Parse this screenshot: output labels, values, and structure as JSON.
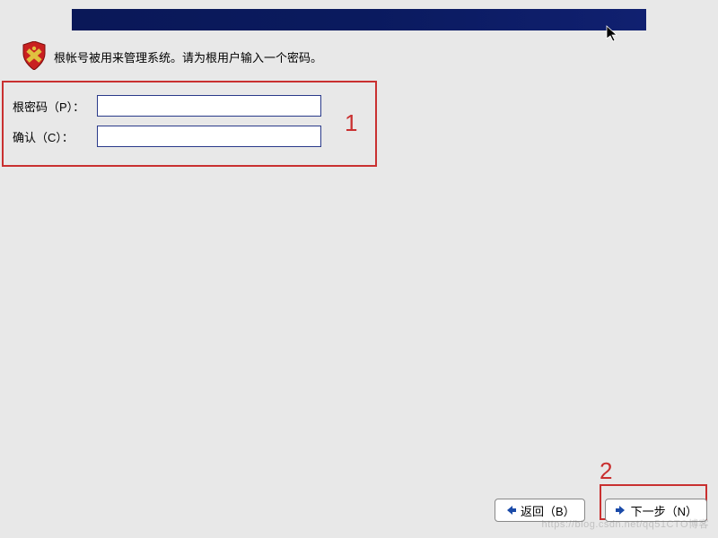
{
  "instruction": "根帐号被用来管理系统。请为根用户输入一个密码。",
  "form": {
    "password_label": "根密码（P）：",
    "password_value": "",
    "confirm_label": "确认（C）：",
    "confirm_value": ""
  },
  "buttons": {
    "back": "返回（B）",
    "next": "下一步（N）"
  },
  "annotations": {
    "one": "1",
    "two": "2"
  },
  "icons": {
    "shield": "shield-icon",
    "arrow_left": "arrow-left-icon",
    "arrow_right": "arrow-right-icon"
  },
  "colors": {
    "highlight": "#c93030",
    "banner": "#0a1a5e",
    "input_border": "#2a3a8a"
  },
  "watermark": "https://blog.csdn.net/qq51CTO博客"
}
